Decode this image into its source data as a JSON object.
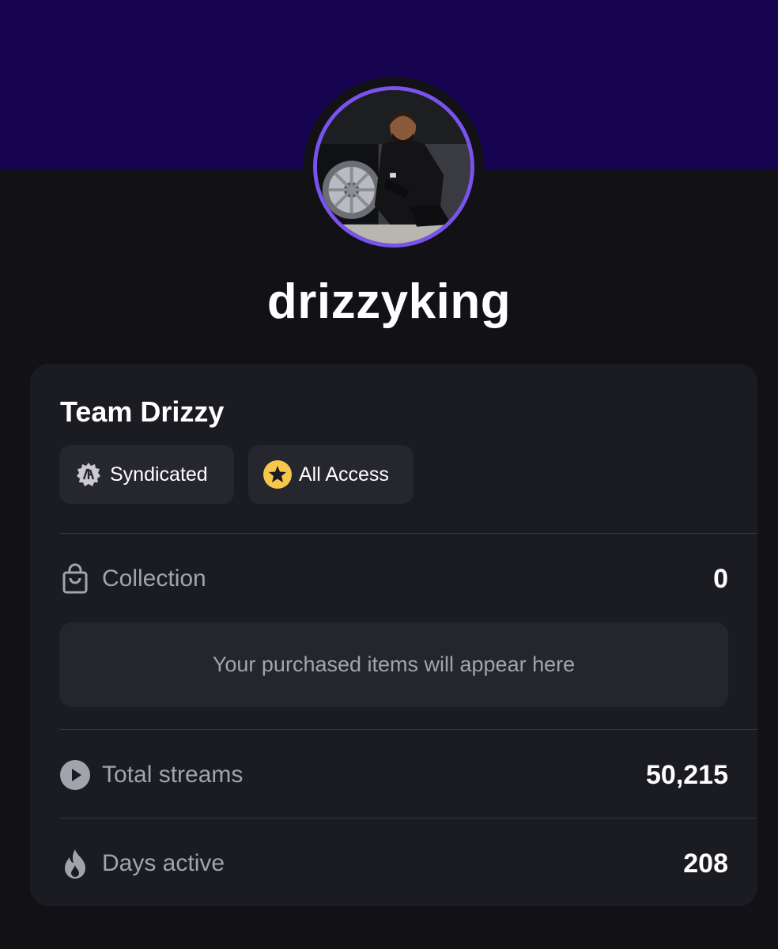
{
  "profile": {
    "username": "drizzyking",
    "avatar_icon": "profile-photo",
    "accent_color": "#7a52ee",
    "banner_color": "#160451"
  },
  "card": {
    "team_name": "Team Drizzy",
    "badges": [
      {
        "label": "Syndicated",
        "icon": "syndicated-badge-icon"
      },
      {
        "label": "All Access",
        "icon": "star-icon",
        "color": "#f5c84c"
      }
    ],
    "collection": {
      "label": "Collection",
      "icon": "shopping-bag-icon",
      "value": "0",
      "empty_message": "Your purchased items will appear here"
    },
    "total_streams": {
      "label": "Total streams",
      "icon": "play-icon",
      "value": "50,215"
    },
    "days_active": {
      "label": "Days active",
      "icon": "flame-icon",
      "value": "208"
    }
  }
}
